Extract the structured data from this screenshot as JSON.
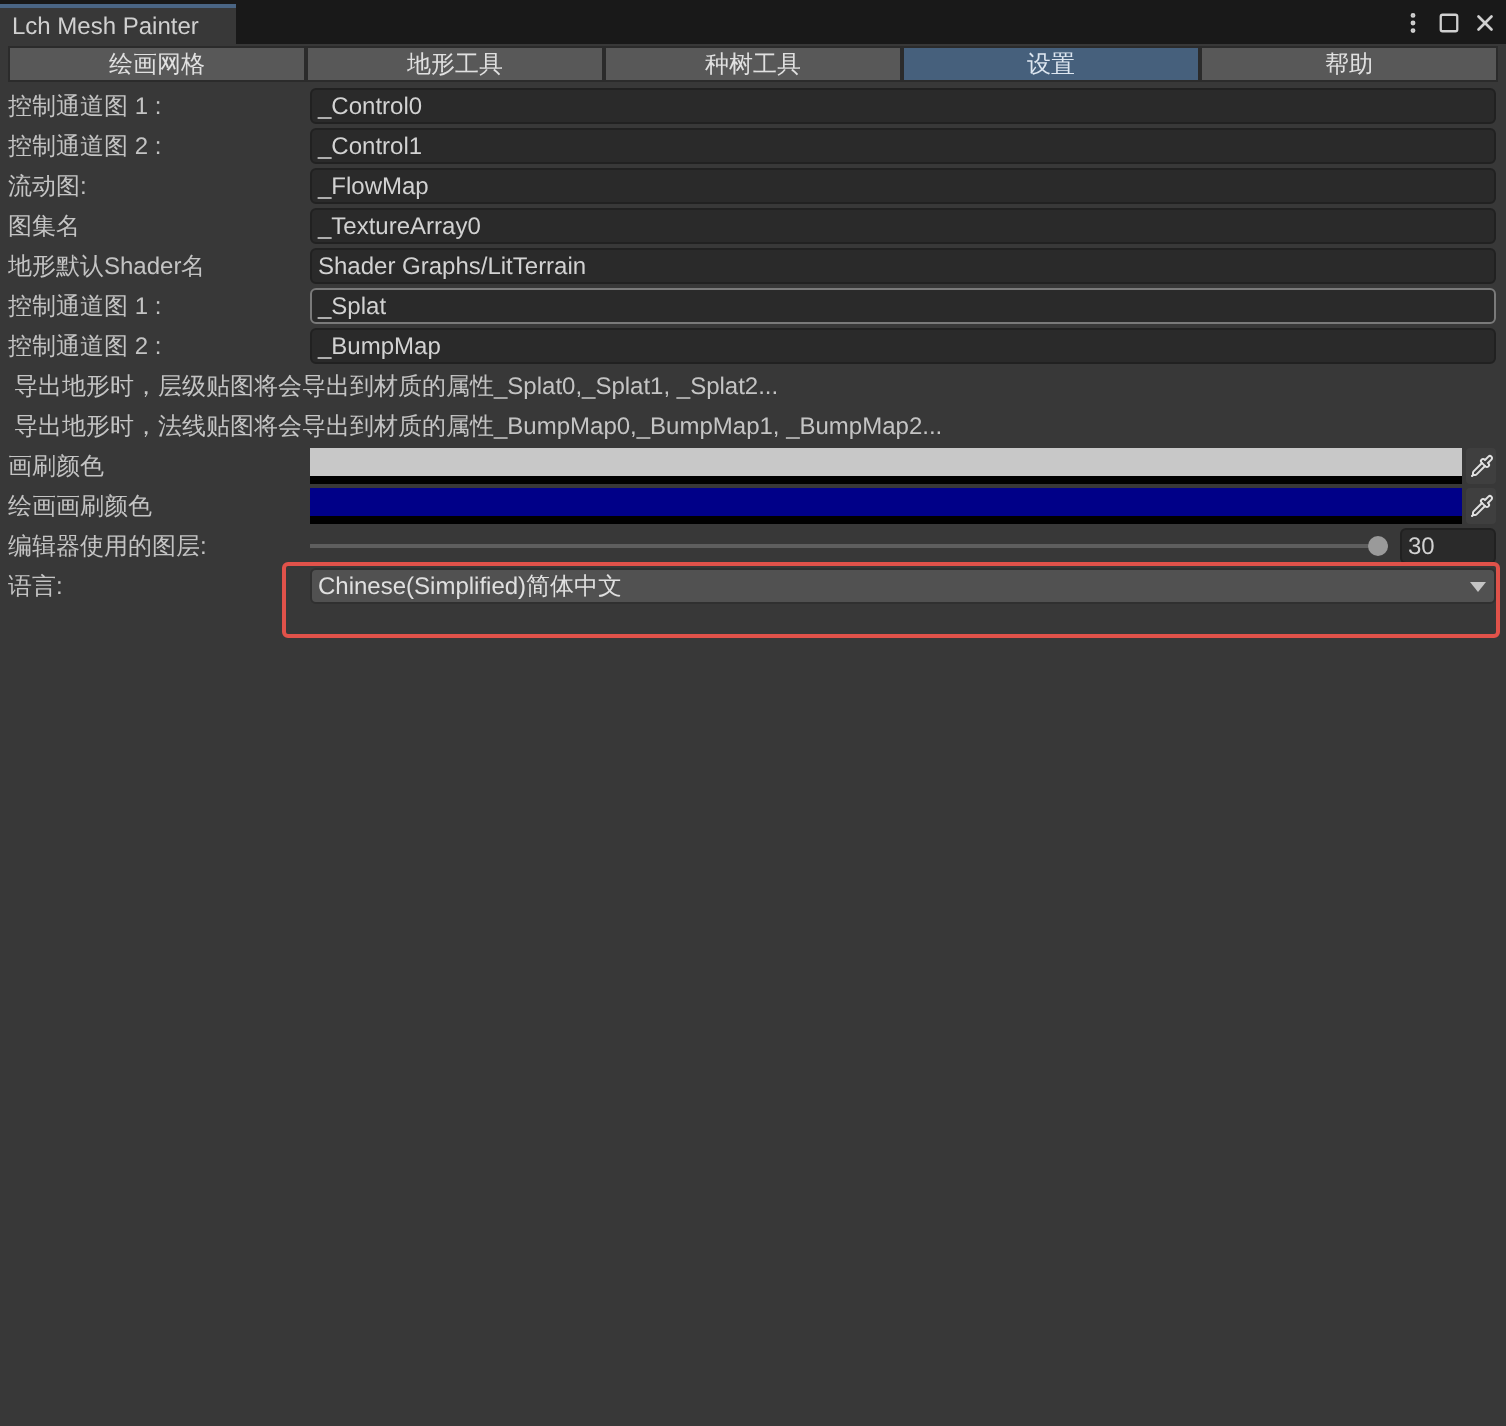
{
  "window": {
    "title": "Lch Mesh Painter"
  },
  "tabs": [
    {
      "label": "绘画网格",
      "selected": false
    },
    {
      "label": "地形工具",
      "selected": false
    },
    {
      "label": "种树工具",
      "selected": false
    },
    {
      "label": "设置",
      "selected": true
    },
    {
      "label": "帮助",
      "selected": false
    }
  ],
  "settings": [
    {
      "kind": "text",
      "label": "控制通道图 1 :",
      "value": "_Control0",
      "focused": false
    },
    {
      "kind": "text",
      "label": "控制通道图 2 :",
      "value": "_Control1",
      "focused": false
    },
    {
      "kind": "text",
      "label": "流动图:",
      "value": "_FlowMap",
      "focused": false
    },
    {
      "kind": "text",
      "label": "图集名",
      "value": "_TextureArray0",
      "focused": false
    },
    {
      "kind": "text",
      "label": "地形默认Shader名",
      "value": "Shader Graphs/LitTerrain",
      "focused": false
    },
    {
      "kind": "text",
      "label": "控制通道图 1 :",
      "value": "_Splat",
      "focused": true
    },
    {
      "kind": "text",
      "label": "控制通道图 2 :",
      "value": "_BumpMap",
      "focused": false
    },
    {
      "kind": "note",
      "text": "导出地形时，层级贴图将会导出到材质的属性_Splat0,_Splat1, _Splat2..."
    },
    {
      "kind": "note",
      "text": "导出地形时，法线贴图将会导出到材质的属性_BumpMap0,_BumpMap1, _BumpMap2..."
    },
    {
      "kind": "color",
      "label": "画刷颜色",
      "color": "#c8c8c8"
    },
    {
      "kind": "color",
      "label": "绘画画刷颜色",
      "color": "#000088"
    },
    {
      "kind": "slider",
      "label": "编辑器使用的图层:",
      "level": 1,
      "value": "30"
    },
    {
      "kind": "dropdown",
      "label": "语言:",
      "value": "Chinese(Simplified)简体中文",
      "highlighted": true
    }
  ]
}
